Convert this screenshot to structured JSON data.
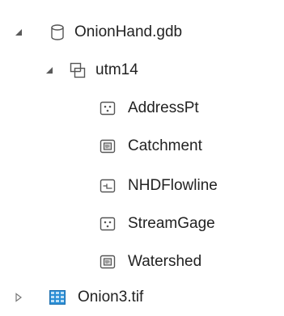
{
  "tree": {
    "gdb": {
      "label": "OnionHand.gdb",
      "icon": "geodatabase-icon",
      "expanded": true
    },
    "dataset": {
      "label": "utm14",
      "icon": "feature-dataset-icon",
      "expanded": true
    },
    "feature_classes": [
      {
        "label": "AddressPt",
        "icon": "point-feature-class-icon"
      },
      {
        "label": "Catchment",
        "icon": "polygon-feature-class-icon"
      },
      {
        "label": "NHDFlowline",
        "icon": "polyline-feature-class-icon"
      },
      {
        "label": "StreamGage",
        "icon": "point-feature-class-icon"
      },
      {
        "label": "Watershed",
        "icon": "polygon-feature-class-icon"
      }
    ],
    "raster": {
      "label": "Onion3.tif",
      "icon": "raster-icon",
      "expanded": false
    }
  },
  "colors": {
    "text": "#222222",
    "icon_stroke": "#555555",
    "arrow": "#5a5a5a",
    "raster_blue": "#2b8fd6",
    "raster_light": "#bfe0f7"
  }
}
